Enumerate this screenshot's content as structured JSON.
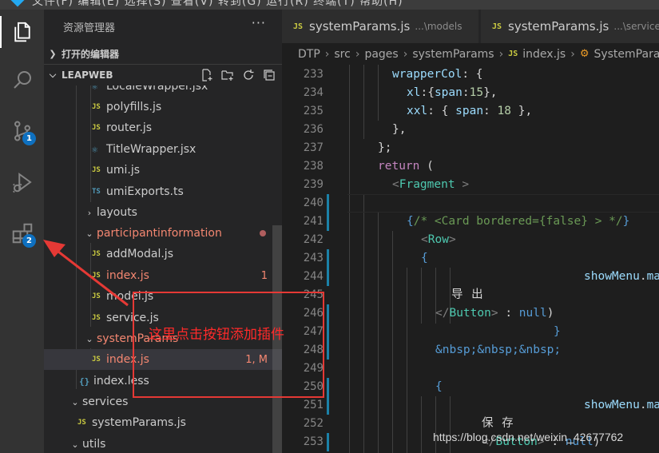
{
  "top_menu": "文件(F) 编辑(E) 选择(S) 查看(V) 转到(G) 运行(R) 终端(T) 帮助(H)",
  "activity_bar": {
    "items": [
      {
        "name": "explorer",
        "icon": "files-icon",
        "badge": null
      },
      {
        "name": "search",
        "icon": "search-icon",
        "badge": null
      },
      {
        "name": "source-control",
        "icon": "source-control-icon",
        "badge": "1"
      },
      {
        "name": "run-debug",
        "icon": "run-debug-icon",
        "badge": null
      },
      {
        "name": "extensions",
        "icon": "extensions-icon",
        "badge": "2"
      }
    ]
  },
  "sidebar": {
    "title": "资源管理器",
    "more": "···",
    "open_editors_label": "打开的编辑器",
    "workspace_label": "LEAPWEB",
    "tree": [
      {
        "name": "LocaleWrapper.jsx",
        "icon": "jsx",
        "depth": 2
      },
      {
        "name": "polyfills.js",
        "icon": "js",
        "depth": 2
      },
      {
        "name": "router.js",
        "icon": "js",
        "depth": 2
      },
      {
        "name": "TitleWrapper.jsx",
        "icon": "jsx",
        "depth": 2
      },
      {
        "name": "umi.js",
        "icon": "js",
        "depth": 2
      },
      {
        "name": "umiExports.ts",
        "icon": "ts",
        "depth": 2
      },
      {
        "name": "layouts",
        "icon": "folder-closed",
        "depth": 1
      },
      {
        "name": "participantinformation",
        "icon": "folder-open",
        "depth": 1,
        "status": "error-dot"
      },
      {
        "name": "addModal.js",
        "icon": "js",
        "depth": 2
      },
      {
        "name": "index.js",
        "icon": "js",
        "depth": 2,
        "status": "1"
      },
      {
        "name": "model.js",
        "icon": "js",
        "depth": 2
      },
      {
        "name": "service.js",
        "icon": "js",
        "depth": 2
      },
      {
        "name": "systemParams",
        "icon": "folder-open",
        "depth": 1
      },
      {
        "name": "index.js",
        "icon": "js",
        "depth": 2,
        "status": "1, M"
      },
      {
        "name": "index.less",
        "icon": "less",
        "depth": 1
      },
      {
        "name": "services",
        "icon": "folder-open",
        "depth": 0
      },
      {
        "name": "systemParams.js",
        "icon": "js",
        "depth": 1
      },
      {
        "name": "utils",
        "icon": "folder-open",
        "depth": 0
      }
    ]
  },
  "tabs": [
    {
      "icon": "JS",
      "name": "systemParams.js",
      "path": "...\\models"
    },
    {
      "icon": "JS",
      "name": "systemParams.js",
      "path": "...\\services"
    }
  ],
  "breadcrumb": {
    "items": [
      "DTP",
      "src",
      "pages",
      "systemParams"
    ],
    "file_icon": "JS",
    "file": "index.js",
    "symbol": "SystemParams"
  },
  "editor": {
    "line_numbers": [
      "233",
      "234",
      "235",
      "236",
      "237",
      "238",
      "239",
      "240",
      "241",
      "242",
      "243",
      "244",
      "245",
      "246",
      "247",
      "248",
      "249",
      "250",
      "251",
      "252",
      "253"
    ]
  },
  "annotation": {
    "text": "这里点击按钮添加插件",
    "watermark": "https://blog.csdn.net/weixin_42677762"
  }
}
